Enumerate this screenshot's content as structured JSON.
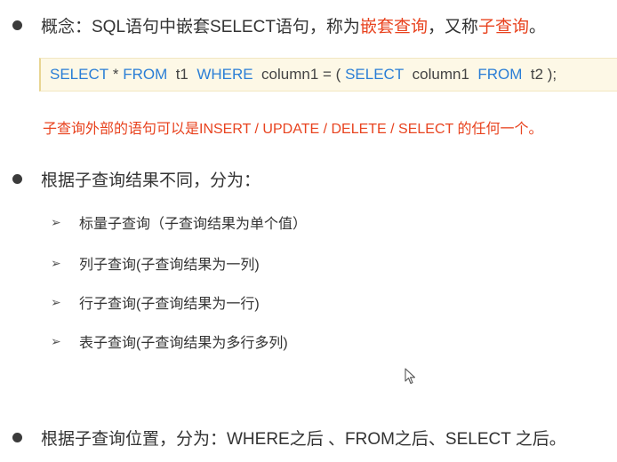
{
  "bullet1": {
    "prefix": "概念：SQL语句中嵌套SELECT语句，称为",
    "highlight1": "嵌套查询",
    "middle": "，又称",
    "highlight2": "子查询",
    "suffix": "。"
  },
  "code": {
    "kw1": "SELECT",
    "p1": " * ",
    "kw2": "FROM",
    "p2": "  t1  ",
    "kw3": "WHERE",
    "p3": "  column1 = ( ",
    "kw4": "SELECT",
    "p4": "  column1  ",
    "kw5": "FROM",
    "p5": "  t2 );"
  },
  "note": "子查询外部的语句可以是INSERT / UPDATE / DELETE / SELECT 的任何一个。",
  "bullet2": "根据子查询结果不同，分为：",
  "sub_items": [
    "标量子查询（子查询结果为单个值）",
    "列子查询(子查询结果为一列)",
    "行子查询(子查询结果为一行)",
    "表子查询(子查询结果为多行多列)"
  ],
  "bullet3": "根据子查询位置，分为：WHERE之后 、FROM之后、SELECT 之后。",
  "icons": {
    "bullet": "bullet-dot-icon",
    "arrow": "arrow-right-icon",
    "cursor": "mouse-cursor-icon"
  },
  "colors": {
    "highlight": "#e8431f",
    "keyword": "#2a7ed6",
    "code_bg": "#fdf8e6"
  }
}
